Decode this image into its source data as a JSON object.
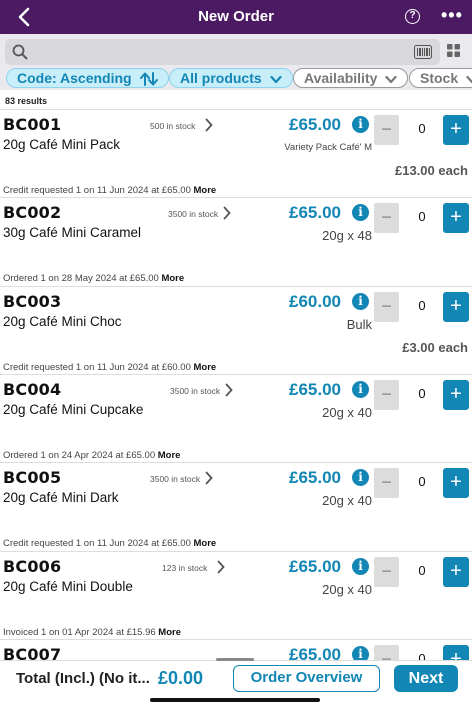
{
  "header": {
    "title": "New Order",
    "help_glyph": "?",
    "more_glyph": "•••"
  },
  "filters": [
    {
      "label": "Code: Ascending",
      "icon": "sort-arrows-icon"
    },
    {
      "label": "All products",
      "icon": "chevron-down-icon"
    },
    {
      "label": "Availability",
      "icon": "chevron-down-icon"
    },
    {
      "label": "Stock",
      "icon": "chevron-down-icon"
    }
  ],
  "results_count": "83 results",
  "products": [
    {
      "code": "BC001",
      "name": "20g Café Mini Pack",
      "stock": "500 in stock",
      "price": "£65.00",
      "pack": "Variety Pack Café' M",
      "qty": "0",
      "each": "£13.00 each",
      "note_prefix": "Credit requested 1 on 11 Jun 2024 at £65.00",
      "note_more": "More"
    },
    {
      "code": "BC002",
      "name": "30g Café Mini Caramel",
      "stock": "3500 in stock",
      "price": "£65.00",
      "pack": "20g x 48",
      "qty": "0",
      "each": "",
      "note_prefix": "Ordered 1 on 28 May 2024 at £65.00",
      "note_more": "More"
    },
    {
      "code": "BC003",
      "name": "20g Café Mini Choc",
      "stock": "",
      "price": "£60.00",
      "pack": "Bulk",
      "qty": "0",
      "each": "£3.00 each",
      "note_prefix": "Credit requested 1 on 11 Jun 2024 at £60.00",
      "note_more": "More"
    },
    {
      "code": "BC004",
      "name": "20g Café Mini Cupcake",
      "stock": "3500 in stock",
      "price": "£65.00",
      "pack": "20g x 40",
      "qty": "0",
      "each": "",
      "note_prefix": "Ordered 1 on 24 Apr 2024 at £65.00",
      "note_more": "More"
    },
    {
      "code": "BC005",
      "name": "20g Café Mini Dark",
      "stock": "3500 in stock",
      "price": "£65.00",
      "pack": "20g x 40",
      "qty": "0",
      "each": "",
      "note_prefix": "Credit requested 1 on 11 Jun 2024 at £65.00",
      "note_more": "More"
    },
    {
      "code": "BC006",
      "name": "20g Café Mini Double",
      "stock": "123 in stock",
      "price": "£65.00",
      "pack": "20g x 40",
      "qty": "0",
      "each": "",
      "note_prefix": "Invoiced 1 on 01 Apr 2024 at £15.96",
      "note_more": "More"
    },
    {
      "code": "BC007",
      "name": "",
      "stock": "",
      "price": "£65.00",
      "pack": "",
      "qty": "0",
      "each": "",
      "note_prefix": "",
      "note_more": ""
    }
  ],
  "footer": {
    "total_label": "Total (Incl.) (No it...",
    "total_value": "£0.00",
    "overview_label": "Order Overview",
    "next_label": "Next"
  },
  "colors": {
    "header": "#4b1a63",
    "accent": "#1286b4",
    "pill_active": "#c8eefa"
  }
}
